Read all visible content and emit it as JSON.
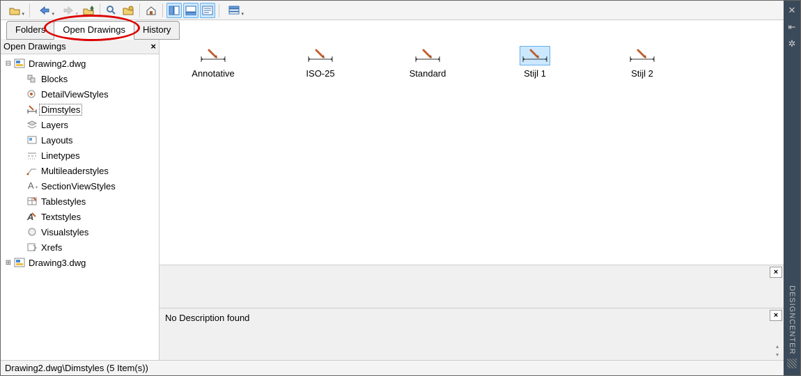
{
  "sidebar_right": {
    "label": "DESIGNCENTER"
  },
  "tabs": {
    "folders": "Folders",
    "open_drawings": "Open Drawings",
    "history": "History",
    "active": "open_drawings"
  },
  "tree": {
    "header": "Open Drawings",
    "nodes": [
      {
        "id": "drawing2",
        "label": "Drawing2.dwg",
        "type": "file",
        "expanded": true,
        "children": [
          {
            "id": "blocks",
            "label": "Blocks"
          },
          {
            "id": "detailviewstyles",
            "label": "DetailViewStyles"
          },
          {
            "id": "dimstyles",
            "label": "Dimstyles",
            "selected": true
          },
          {
            "id": "layers",
            "label": "Layers"
          },
          {
            "id": "layouts",
            "label": "Layouts"
          },
          {
            "id": "linetypes",
            "label": "Linetypes"
          },
          {
            "id": "multileaderstyles",
            "label": "Multileaderstyles"
          },
          {
            "id": "sectionviewstyles",
            "label": "SectionViewStyles"
          },
          {
            "id": "tablestyles",
            "label": "Tablestyles"
          },
          {
            "id": "textstyles",
            "label": "Textstyles"
          },
          {
            "id": "visualstyles",
            "label": "Visualstyles"
          },
          {
            "id": "xrefs",
            "label": "Xrefs"
          }
        ]
      },
      {
        "id": "drawing3",
        "label": "Drawing3.dwg",
        "type": "file",
        "expanded": false
      }
    ]
  },
  "items": [
    {
      "id": "annotative",
      "label": "Annotative",
      "selected": false
    },
    {
      "id": "iso25",
      "label": "ISO-25",
      "selected": false
    },
    {
      "id": "standard",
      "label": "Standard",
      "selected": false
    },
    {
      "id": "stijl1",
      "label": "Stijl 1",
      "selected": true
    },
    {
      "id": "stijl2",
      "label": "Stijl 2",
      "selected": false
    }
  ],
  "description": "No Description found",
  "statusbar": "Drawing2.dwg\\Dimstyles (5 Item(s))",
  "highlight": {
    "tab": "open_drawings"
  }
}
